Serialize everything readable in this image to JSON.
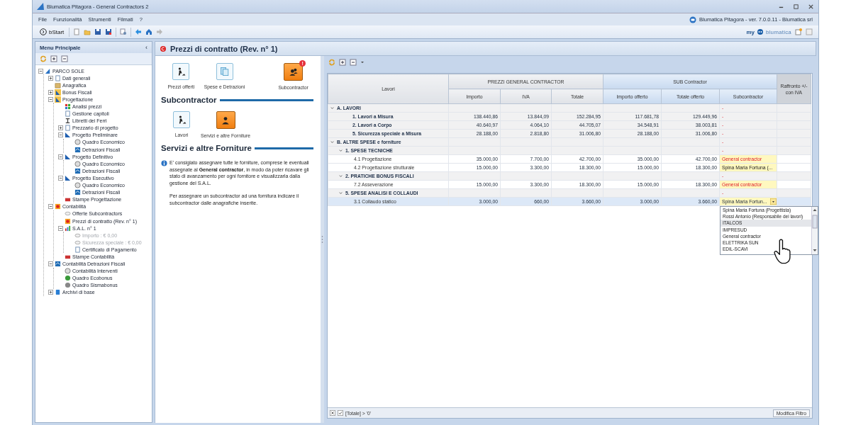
{
  "window": {
    "title": "Blumatica Pitagora - General Contractors 2"
  },
  "menu": [
    "File",
    "Funzionalità",
    "Strumenti",
    "Filmati",
    "?"
  ],
  "app_info": "Blumatica Pitagora - ver. 7.0.0.11 - Blumatica srl",
  "toolbar": {
    "start": "bStart",
    "brand_prefix": "my",
    "brand_name": "blumatica"
  },
  "sidebar": {
    "title": "Menu Principale",
    "collapse": "‹",
    "tree": [
      {
        "label": "PARCO SOLE",
        "kind": "site",
        "expanded": true,
        "disabled": false,
        "children": [
          {
            "label": "Dati generali",
            "kind": "doc",
            "expanded": false,
            "disabled": false
          },
          {
            "label": "Anagrafica",
            "kind": "folder",
            "disabled": false
          },
          {
            "label": "Bonus Fiscali",
            "kind": "ruler",
            "expanded": false,
            "disabled": false
          },
          {
            "label": "Progettazione",
            "kind": "ruler",
            "expanded": true,
            "disabled": false,
            "children": [
              {
                "label": "Analisi prezzi",
                "kind": "grid",
                "disabled": false
              },
              {
                "label": "Gestione capitoli",
                "kind": "doc",
                "disabled": false
              },
              {
                "label": "Libretti dei Ferri",
                "kind": "beam",
                "disabled": false
              },
              {
                "label": "Prezzario di progetto",
                "kind": "doc",
                "expanded": false,
                "disabled": false
              },
              {
                "label": "Progetto Preliminare",
                "kind": "square",
                "expanded": true,
                "disabled": false,
                "children": [
                  {
                    "label": "Quadro Economico",
                    "kind": "clock",
                    "disabled": false
                  },
                  {
                    "label": "Detrazioni Fiscali",
                    "kind": "house",
                    "disabled": false
                  }
                ]
              },
              {
                "label": "Progetto Definitivo",
                "kind": "square",
                "expanded": true,
                "disabled": false,
                "children": [
                  {
                    "label": "Quadro Economico",
                    "kind": "clock",
                    "disabled": false
                  },
                  {
                    "label": "Detrazioni Fiscali",
                    "kind": "house",
                    "disabled": false
                  }
                ]
              },
              {
                "label": "Progetto Esecutivo",
                "kind": "square",
                "expanded": true,
                "disabled": false,
                "children": [
                  {
                    "label": "Quadro Economico",
                    "kind": "clock",
                    "disabled": false
                  },
                  {
                    "label": "Detrazioni Fiscali",
                    "kind": "house",
                    "disabled": false
                  }
                ]
              },
              {
                "label": "Stampe Progettazione",
                "kind": "printer",
                "disabled": false
              }
            ]
          },
          {
            "label": "Contabilità",
            "kind": "euro",
            "expanded": true,
            "disabled": false,
            "children": [
              {
                "label": "Offerte Subcontractors",
                "kind": "coin",
                "disabled": false
              },
              {
                "label": "Prezzi di contratto (Rev. n° 1)",
                "kind": "euro",
                "disabled": false
              },
              {
                "label": "S.A.L. n° 1",
                "kind": "chart",
                "expanded": true,
                "disabled": false,
                "children": [
                  {
                    "label": "Importo : € 0,00",
                    "kind": "coin",
                    "disabled": true
                  },
                  {
                    "label": "Sicurezza speciale : € 0,00",
                    "kind": "coin",
                    "disabled": true
                  },
                  {
                    "label": "Certificato di Pagamento",
                    "kind": "doc",
                    "disabled": false
                  }
                ]
              },
              {
                "label": "Stampe Contabilità",
                "kind": "printer",
                "disabled": false
              }
            ]
          },
          {
            "label": "Contabilità Detrazioni Fiscali",
            "kind": "house",
            "expanded": true,
            "disabled": false,
            "children": [
              {
                "label": "Contabilità Interventi",
                "kind": "clock",
                "disabled": false
              },
              {
                "label": "Quadro Ecobonus",
                "kind": "eco",
                "disabled": false
              },
              {
                "label": "Quadro Sismabonus",
                "kind": "sisma",
                "disabled": false
              }
            ]
          },
          {
            "label": "Archivi di base",
            "kind": "db",
            "expanded": false,
            "disabled": false
          }
        ]
      }
    ]
  },
  "page": {
    "title": "Prezzi di contratto (Rev. n° 1)",
    "tiles": [
      {
        "label": "Prezzi offerti",
        "kind": "worker",
        "selected": false
      },
      {
        "label": "Spese e Detrazioni",
        "kind": "docs",
        "selected": false
      },
      {
        "label": "Subcontractor",
        "kind": "team",
        "selected": true,
        "badge": "!"
      }
    ],
    "section_1": "Subcontractor",
    "sub_tiles": [
      {
        "label": "Lavori",
        "kind": "worker",
        "selected": false
      },
      {
        "label": "Servizi e altre Forniture",
        "kind": "person",
        "selected": true
      }
    ],
    "section_2": "Servizi e altre Forniture",
    "info": [
      "E' consiglato assegnare tutte le forniture, comprese le eventuali assegnate al **General contractor**, in modo da poter ricavare gli stato di avanzamento per ogni fornitore e visualizzarla dalla gestione del S.A.L.",
      "Per assegnare un subcontractor ad una fornitura indicare il subcontractor dalle anagrafiche inserite."
    ]
  },
  "table": {
    "label_column": "Lavori",
    "groups": [
      {
        "label": "PREZZI GENERAL CONTRACTOR",
        "kind": "gc",
        "columns": [
          "Importo",
          "IVA",
          "Totale"
        ]
      },
      {
        "label": "SUB Contractor",
        "kind": "sub",
        "columns": [
          "Importo offerto",
          "Totale offerto",
          "Subcontractor"
        ]
      }
    ],
    "compare_column": "Raffronto +/- con IVA",
    "rows": [
      {
        "label": "A. LAVORI",
        "kind": "group",
        "expanded": true,
        "selected": false,
        "sub": {
          "text": "-",
          "kind": "none"
        },
        "children": [
          {
            "label": "1. Lavori a Misura",
            "kind": "item",
            "selected": false,
            "values": [
              "138.440,86",
              "13.844,09",
              "152.284,95",
              "117.681,78",
              "129.449,96"
            ],
            "sub": {
              "text": "-",
              "kind": "none"
            }
          },
          {
            "label": "2. Lavori a Corpo",
            "kind": "item",
            "selected": false,
            "values": [
              "40.640,97",
              "4.064,10",
              "44.705,07",
              "34.548,91",
              "38.003,81"
            ],
            "sub": {
              "text": "-",
              "kind": "none"
            }
          },
          {
            "label": "5. Sicurezza speciale a Misura",
            "kind": "item",
            "selected": false,
            "values": [
              "28.188,00",
              "2.818,80",
              "31.006,80",
              "28.188,00",
              "31.006,80"
            ],
            "sub": {
              "text": "-",
              "kind": "none"
            }
          }
        ]
      },
      {
        "label": "B. ALTRE SPESE e forniture",
        "kind": "group",
        "expanded": true,
        "selected": false,
        "sub": {
          "text": "-",
          "kind": "none"
        },
        "children": [
          {
            "label": "1. SPESE TECNICHE",
            "kind": "group",
            "expanded": true,
            "selected": false,
            "sub": {
              "text": "-",
              "kind": "none"
            },
            "children": [
              {
                "label": "4.1 Progettazione",
                "kind": "detail",
                "selected": false,
                "values": [
                  "35.000,00",
                  "7.700,00",
                  "42.700,00",
                  "35.000,00",
                  "42.700,00"
                ],
                "sub": {
                  "text": "General contractor",
                  "kind": "general"
                }
              },
              {
                "label": "4.2 Progettazione strutturale",
                "kind": "detail",
                "selected": false,
                "values": [
                  "15.000,00",
                  "3.300,00",
                  "18.300,00",
                  "15.000,00",
                  "18.300,00"
                ],
                "sub": {
                  "text": "Spina Maria Fortuna (...",
                  "kind": "assigned"
                }
              }
            ]
          },
          {
            "label": "2. PRATICHE BONUS FISCALI",
            "kind": "group",
            "expanded": true,
            "selected": false,
            "sub": {
              "text": "-",
              "kind": "none"
            },
            "children": [
              {
                "label": "7.2 Asseverazione",
                "kind": "detail",
                "selected": false,
                "values": [
                  "15.000,00",
                  "3.300,00",
                  "18.300,00",
                  "15.000,00",
                  "18.300,00"
                ],
                "sub": {
                  "text": "General contractor",
                  "kind": "general"
                }
              }
            ]
          },
          {
            "label": "5. SPESE ANALISI E COLLAUDI",
            "kind": "group",
            "expanded": true,
            "selected": false,
            "sub": {
              "text": "-",
              "kind": "none"
            },
            "children": [
              {
                "label": "3.1 Collaudo statico",
                "kind": "detail",
                "selected": true,
                "values": [
                  "3.000,00",
                  "660,00",
                  "3.660,00",
                  "3.000,00",
                  "3.660,00"
                ],
                "sub": {
                  "text": "Spina Maria Fortun...",
                  "kind": "editing"
                }
              }
            ]
          }
        ]
      }
    ],
    "dropdown": [
      {
        "label": "Spina Maria Fortuna (Progettista)",
        "selected": false
      },
      {
        "label": "Rossi Antonio (Responsabile dei lavori)",
        "selected": false
      },
      {
        "label": "ITALCOS",
        "selected": true
      },
      {
        "label": "IMPRESUD",
        "selected": false
      },
      {
        "label": "General contractor",
        "selected": false
      },
      {
        "label": "ELETTRIKA SUN",
        "selected": false
      },
      {
        "label": "EDIL-SCAVI",
        "selected": false
      }
    ],
    "filter": {
      "enabled": true,
      "expression": "[Totale] > '0'",
      "button": "Modifica Filtro"
    }
  }
}
